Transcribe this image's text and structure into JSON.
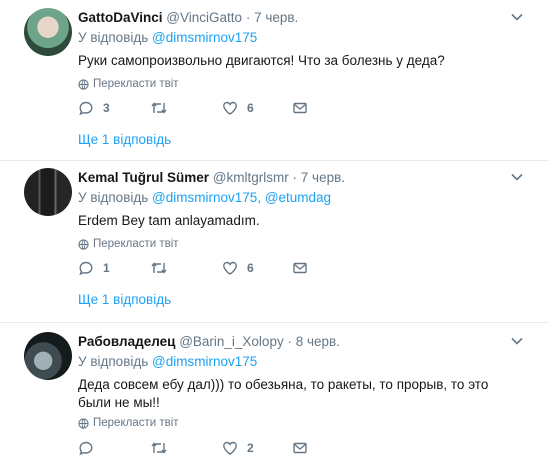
{
  "colors": {
    "link": "#1da1f2",
    "muted": "#657786",
    "text": "#14171a",
    "divider": "#e6ecf0"
  },
  "tweets": [
    {
      "name": "GattoDaVinci",
      "handle": "@VinciGatto",
      "separator": "·",
      "date": "7 черв.",
      "replying_label": "У відповідь",
      "mentions": [
        "@dimsmirnov175"
      ],
      "text": "Руки самопроизвольно двигаются! Что за болезнь у деда?",
      "translate": "Перекласти твіт",
      "counts": {
        "replies": "3",
        "retweets": "",
        "likes": "6"
      },
      "more_replies": "Ще 1 відповідь"
    },
    {
      "name": "Kemal Tuğrul Sümer",
      "handle": "@kmltgrlsmr",
      "separator": "·",
      "date": "7 черв.",
      "replying_label": "У відповідь",
      "mentions": [
        "@dimsmirnov175",
        "@etumdag"
      ],
      "mention_joiner": ", ",
      "text": "Erdem Bey tam anlayamadım.",
      "translate": "Перекласти твіт",
      "counts": {
        "replies": "1",
        "retweets": "",
        "likes": "6"
      },
      "more_replies": "Ще 1 відповідь"
    },
    {
      "name": "Рабовладелец",
      "handle": "@Barin_i_Xolopy",
      "separator": "·",
      "date": "8 черв.",
      "replying_label": "У відповідь",
      "mentions": [
        "@dimsmirnov175"
      ],
      "text": "Деда совсем ебу дал))) то обезьяна, то ракеты, то прорыв, то это были не мы!!",
      "translate": "Перекласти твіт",
      "counts": {
        "replies": "",
        "retweets": "",
        "likes": "2"
      }
    }
  ],
  "icons": [
    "chevron-down-icon",
    "globe-icon",
    "reply-icon",
    "retweet-icon",
    "heart-icon",
    "envelope-icon"
  ]
}
